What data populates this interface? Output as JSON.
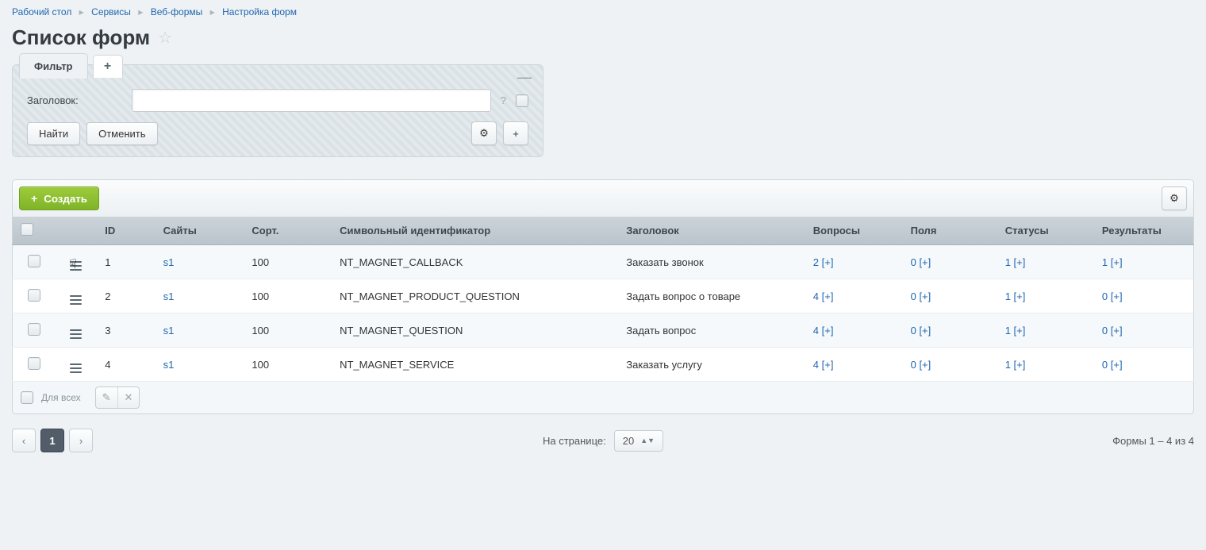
{
  "breadcrumb": [
    {
      "label": "Рабочий стол"
    },
    {
      "label": "Сервисы"
    },
    {
      "label": "Веб-формы"
    },
    {
      "label": "Настройка форм"
    }
  ],
  "page_title": "Список форм",
  "filter": {
    "tab_label": "Фильтр",
    "field_label": "Заголовок:",
    "value": "",
    "help": "?",
    "find_label": "Найти",
    "cancel_label": "Отменить",
    "collapse_glyph": "—"
  },
  "toolbar": {
    "create_label": "Создать"
  },
  "table": {
    "headers": {
      "id": "ID",
      "sites": "Сайты",
      "sort": "Сорт.",
      "sid": "Символьный идентификатор",
      "title": "Заголовок",
      "questions": "Вопросы",
      "fields": "Поля",
      "statuses": "Статусы",
      "results": "Результаты"
    },
    "rows": [
      {
        "id": "1",
        "sites": "s1",
        "sort": "100",
        "sid": "NT_MAGNET_CALLBACK",
        "title": "Заказать звонок",
        "questions": "2",
        "fields": "0",
        "statuses": "1",
        "results": "1"
      },
      {
        "id": "2",
        "sites": "s1",
        "sort": "100",
        "sid": "NT_MAGNET_PRODUCT_QUESTION",
        "title": "Задать вопрос о товаре",
        "questions": "4",
        "fields": "0",
        "statuses": "1",
        "results": "0"
      },
      {
        "id": "3",
        "sites": "s1",
        "sort": "100",
        "sid": "NT_MAGNET_QUESTION",
        "title": "Задать вопрос",
        "questions": "4",
        "fields": "0",
        "statuses": "1",
        "results": "0"
      },
      {
        "id": "4",
        "sites": "s1",
        "sort": "100",
        "sid": "NT_MAGNET_SERVICE",
        "title": "Заказать услугу",
        "questions": "4",
        "fields": "0",
        "statuses": "1",
        "results": "0"
      }
    ],
    "plus_add": "[+]"
  },
  "footer": {
    "for_all_label": "Для всех"
  },
  "pagination": {
    "current": "1",
    "per_page_label": "На странице:",
    "per_page_value": "20",
    "total_text": "Формы 1 – 4 из 4"
  }
}
